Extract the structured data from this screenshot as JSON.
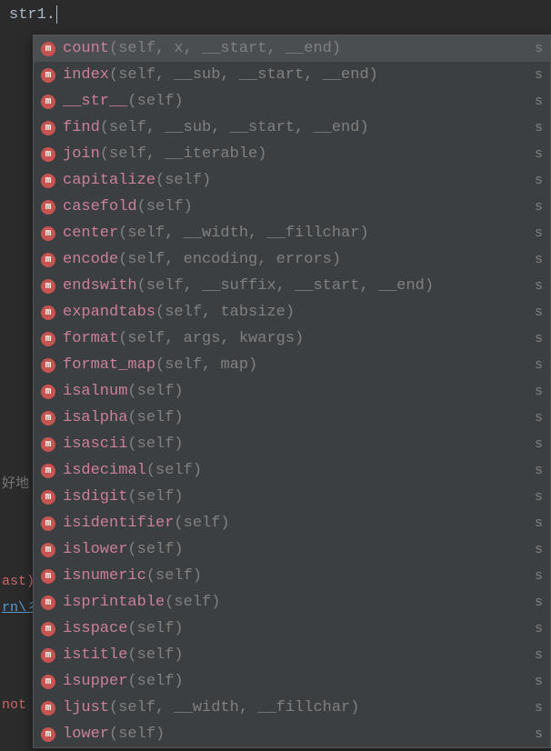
{
  "editor": {
    "typed": "str1."
  },
  "background_fragments": {
    "frag1": "好地",
    "frag2": "ast)",
    "frag3": "rn\\彳",
    "frag4": "not"
  },
  "popup": {
    "icon_glyph": "m",
    "selected_index": 0,
    "items": [
      {
        "name": "count",
        "params": "(self, x, __start, __end)",
        "origin": "s"
      },
      {
        "name": "index",
        "params": "(self, __sub, __start, __end)",
        "origin": "s"
      },
      {
        "name": "__str__",
        "params": "(self)",
        "origin": "s"
      },
      {
        "name": "find",
        "params": "(self, __sub, __start, __end)",
        "origin": "s"
      },
      {
        "name": "join",
        "params": "(self, __iterable)",
        "origin": "s"
      },
      {
        "name": "capitalize",
        "params": "(self)",
        "origin": "s"
      },
      {
        "name": "casefold",
        "params": "(self)",
        "origin": "s"
      },
      {
        "name": "center",
        "params": "(self, __width, __fillchar)",
        "origin": "s"
      },
      {
        "name": "encode",
        "params": "(self, encoding, errors)",
        "origin": "s"
      },
      {
        "name": "endswith",
        "params": "(self, __suffix, __start, __end)",
        "origin": "s"
      },
      {
        "name": "expandtabs",
        "params": "(self, tabsize)",
        "origin": "s"
      },
      {
        "name": "format",
        "params": "(self, args, kwargs)",
        "origin": "s"
      },
      {
        "name": "format_map",
        "params": "(self, map)",
        "origin": "s"
      },
      {
        "name": "isalnum",
        "params": "(self)",
        "origin": "s"
      },
      {
        "name": "isalpha",
        "params": "(self)",
        "origin": "s"
      },
      {
        "name": "isascii",
        "params": "(self)",
        "origin": "s"
      },
      {
        "name": "isdecimal",
        "params": "(self)",
        "origin": "s"
      },
      {
        "name": "isdigit",
        "params": "(self)",
        "origin": "s"
      },
      {
        "name": "isidentifier",
        "params": "(self)",
        "origin": "s"
      },
      {
        "name": "islower",
        "params": "(self)",
        "origin": "s"
      },
      {
        "name": "isnumeric",
        "params": "(self)",
        "origin": "s"
      },
      {
        "name": "isprintable",
        "params": "(self)",
        "origin": "s"
      },
      {
        "name": "isspace",
        "params": "(self)",
        "origin": "s"
      },
      {
        "name": "istitle",
        "params": "(self)",
        "origin": "s"
      },
      {
        "name": "isupper",
        "params": "(self)",
        "origin": "s"
      },
      {
        "name": "ljust",
        "params": "(self, __width, __fillchar)",
        "origin": "s"
      },
      {
        "name": "lower",
        "params": "(self)",
        "origin": "s"
      }
    ]
  }
}
